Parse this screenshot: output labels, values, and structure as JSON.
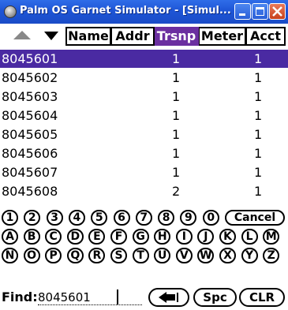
{
  "window": {
    "title": "Palm OS Garnet Simulator - [Simul..."
  },
  "columns": {
    "name": "Name",
    "addr": "Addr",
    "trsnp": "Trsnp",
    "meter": "Meter",
    "acct": "Acct"
  },
  "rows": [
    {
      "id": "8045601",
      "trsnp": "1",
      "acct": "1",
      "selected": true
    },
    {
      "id": "8045602",
      "trsnp": "1",
      "acct": "1"
    },
    {
      "id": "8045603",
      "trsnp": "1",
      "acct": "1"
    },
    {
      "id": "8045604",
      "trsnp": "1",
      "acct": "1"
    },
    {
      "id": "8045605",
      "trsnp": "1",
      "acct": "1"
    },
    {
      "id": "8045606",
      "trsnp": "1",
      "acct": "1"
    },
    {
      "id": "8045607",
      "trsnp": "1",
      "acct": "1"
    },
    {
      "id": "8045608",
      "trsnp": "2",
      "acct": "1"
    }
  ],
  "keypad": {
    "row1": [
      "1",
      "2",
      "3",
      "4",
      "5",
      "6",
      "7",
      "8",
      "9",
      "0",
      "Cancel"
    ],
    "row2": [
      "A",
      "B",
      "C",
      "D",
      "E",
      "F",
      "G",
      "H",
      "I",
      "J",
      "K",
      "L",
      "M"
    ],
    "row3": [
      "N",
      "O",
      "P",
      "Q",
      "R",
      "S",
      "T",
      "U",
      "V",
      "W",
      "X",
      "Y",
      "Z"
    ]
  },
  "find": {
    "label": "Find:",
    "value": "8045601",
    "spc": "Spc",
    "clr": "CLR"
  },
  "colors": {
    "titlebar": "#1e55d6",
    "selection": "#4a2aa2",
    "active_column": "#6b2fa0"
  }
}
